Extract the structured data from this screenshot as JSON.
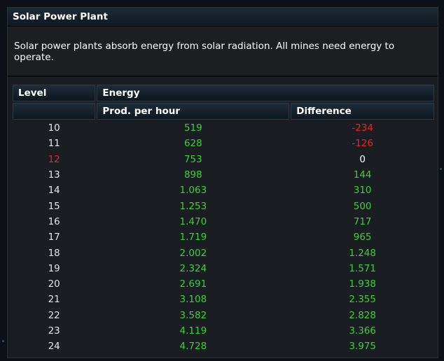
{
  "building": {
    "title": "Solar Power Plant",
    "description": "Solar power plants absorb energy from solar radiation. All mines need energy to operate."
  },
  "table": {
    "headers": {
      "level": "Level",
      "energy": "Energy",
      "prod": "Prod. per hour",
      "difference": "Difference"
    },
    "current_level": "12",
    "rows": [
      {
        "level": "10",
        "prod": "519",
        "diff": "-234"
      },
      {
        "level": "11",
        "prod": "628",
        "diff": "-126"
      },
      {
        "level": "12",
        "prod": "753",
        "diff": "0"
      },
      {
        "level": "13",
        "prod": "898",
        "diff": "144"
      },
      {
        "level": "14",
        "prod": "1.063",
        "diff": "310"
      },
      {
        "level": "15",
        "prod": "1.253",
        "diff": "500"
      },
      {
        "level": "16",
        "prod": "1.470",
        "diff": "717"
      },
      {
        "level": "17",
        "prod": "1.719",
        "diff": "965"
      },
      {
        "level": "18",
        "prod": "2.002",
        "diff": "1.248"
      },
      {
        "level": "19",
        "prod": "2.324",
        "diff": "1.571"
      },
      {
        "level": "20",
        "prod": "2.691",
        "diff": "1.938"
      },
      {
        "level": "21",
        "prod": "3.108",
        "diff": "2.355"
      },
      {
        "level": "22",
        "prod": "3.582",
        "diff": "2.828"
      },
      {
        "level": "23",
        "prod": "4.119",
        "diff": "3.366"
      },
      {
        "level": "24",
        "prod": "4.728",
        "diff": "3.975"
      }
    ]
  },
  "colors": {
    "positive": "#39d138",
    "negative": "#ee2222",
    "neutral": "#ffffff",
    "current_level": "#ee2222"
  }
}
